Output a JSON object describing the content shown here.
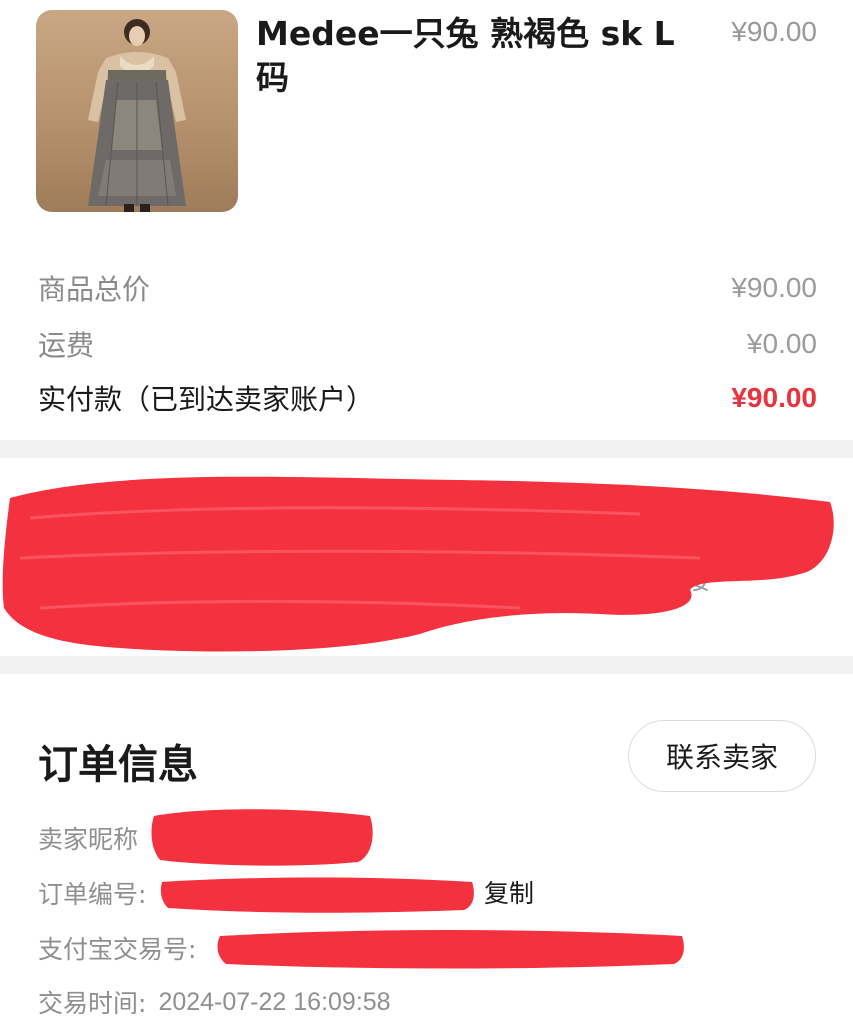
{
  "product": {
    "title": "Medee一只兔 熟褐色 sk L码",
    "price": "¥90.00",
    "image_alt": "product-photo"
  },
  "summary": {
    "items_label": "商品总价",
    "items_value": "¥90.00",
    "shipping_label": "运费",
    "shipping_value": "¥0.00",
    "paid_label": "实付款（已到达卖家账户）",
    "paid_value": "¥90.00"
  },
  "address": {
    "visible_fragment": "楼"
  },
  "order_info": {
    "title": "订单信息",
    "contact_button": "联系卖家",
    "seller_label": "卖家昵称",
    "order_no_label": "订单编号:",
    "copy_label": "复制",
    "alipay_label": "支付宝交易号:",
    "time_label": "交易时间:",
    "time_value": "2024-07-22 16:09:58"
  },
  "colors": {
    "accent_red": "#e8343d",
    "redaction": "#f4323f",
    "muted_text": "#8f8f8f",
    "divider": "#f2f2f2"
  }
}
